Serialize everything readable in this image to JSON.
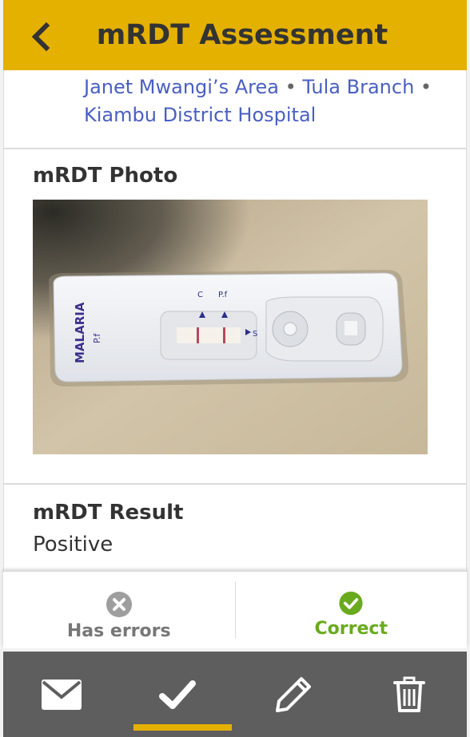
{
  "header": {
    "title": "mRDT Assessment",
    "back_icon": "back-arrow-icon"
  },
  "location": {
    "area": "Janet Mwangi’s Area",
    "separator": "•",
    "branch": "Tula Branch",
    "hospital": "Kiambu District Hospital"
  },
  "photo_section": {
    "title": "mRDT Photo",
    "cassette_label": "MALARIA",
    "cassette_sublabel": "P.f",
    "marker_c": "C",
    "marker_pf": "P.f",
    "marker_s": "S"
  },
  "result_section": {
    "title": "mRDT Result",
    "value": "Positive"
  },
  "verification": {
    "has_errors_label": "Has errors",
    "correct_label": "Correct",
    "selected": "Correct"
  },
  "toolbar": {
    "items": [
      "envelope-icon",
      "checkmark-icon",
      "pencil-icon",
      "trash-icon"
    ],
    "active": "checkmark-icon"
  },
  "colors": {
    "header": "#e5b100",
    "link": "#4a5fc1",
    "correct": "#6aaa1e",
    "toolbar": "#5e5e5e"
  }
}
